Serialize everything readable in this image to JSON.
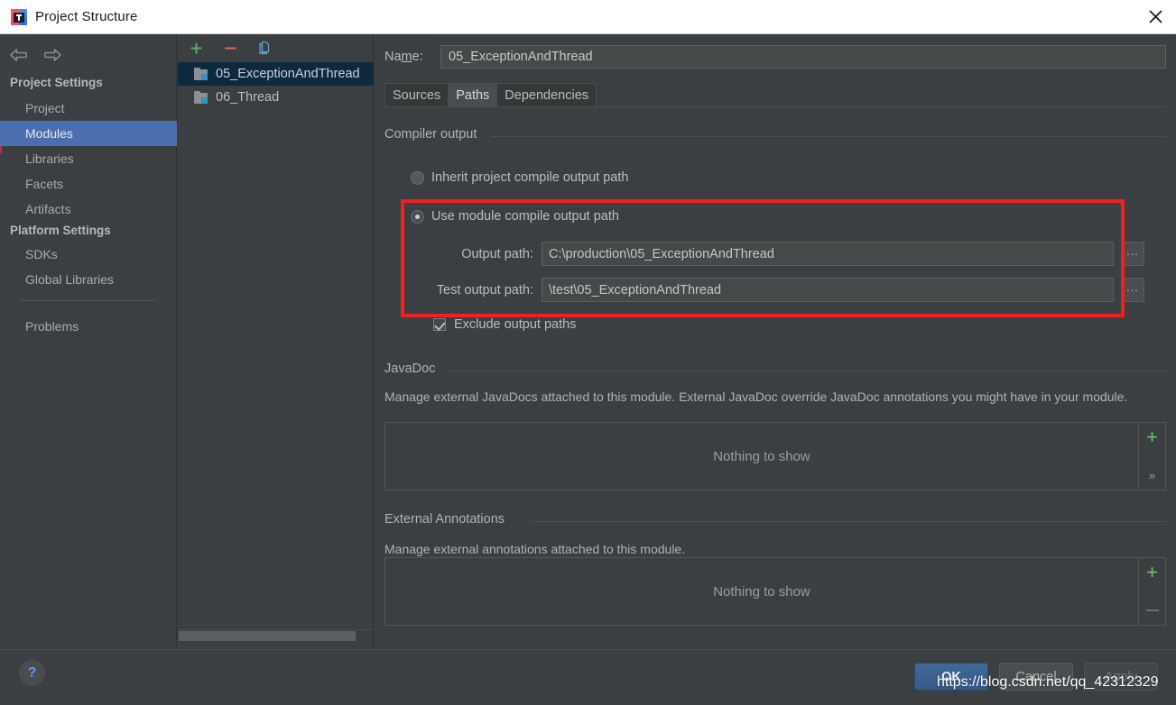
{
  "window": {
    "title": "Project Structure",
    "app_icon": "intellij-idea-icon",
    "close_icon": "close-icon"
  },
  "navigation": {
    "back_icon": "arrow-left-icon",
    "forward_icon": "arrow-right-icon"
  },
  "sidebar": {
    "sections": [
      {
        "header": "Project Settings",
        "items": [
          {
            "label": "Project",
            "selected": false
          },
          {
            "label": "Modules",
            "selected": true
          },
          {
            "label": "Libraries",
            "selected": false
          },
          {
            "label": "Facets",
            "selected": false
          },
          {
            "label": "Artifacts",
            "selected": false
          }
        ]
      },
      {
        "header": "Platform Settings",
        "items": [
          {
            "label": "SDKs",
            "selected": false
          },
          {
            "label": "Global Libraries",
            "selected": false
          }
        ]
      }
    ],
    "extra_item": {
      "label": "Problems",
      "selected": false
    },
    "selection_color": "#4b6eaf"
  },
  "module_panel": {
    "toolbar": [
      {
        "name": "add-module-button",
        "icon": "plus-icon",
        "color": "#59a869"
      },
      {
        "name": "remove-module-button",
        "icon": "minus-icon",
        "color": "#d9685f"
      },
      {
        "name": "copy-module-button",
        "icon": "copy-icon",
        "color": "#5a9ec9"
      }
    ],
    "modules": [
      {
        "label": "05_ExceptionAndThread",
        "selected": true
      },
      {
        "label": "06_Thread",
        "selected": false
      }
    ],
    "selection_color": "#0d293e",
    "scrollbar": "horizontal-scrollbar"
  },
  "main": {
    "name_label": "Name:",
    "name_label_mnemonic": "m",
    "name_value": "05_ExceptionAndThread",
    "tabs": [
      {
        "label": "Sources",
        "active": false
      },
      {
        "label": "Paths",
        "active": true
      },
      {
        "label": "Dependencies",
        "active": false
      }
    ],
    "compiler_output": {
      "group_title": "Compiler output",
      "inherit_option": {
        "label": "Inherit project compile output path",
        "selected": false
      },
      "module_option": {
        "label": "Use module compile output path",
        "selected": true
      },
      "output_path": {
        "label": "Output path:",
        "value": "C:\\production\\05_ExceptionAndThread",
        "browse_label": "..."
      },
      "test_output_path": {
        "label": "Test output path:",
        "value": "\\test\\05_ExceptionAndThread",
        "browse_label": "..."
      },
      "exclude_checkbox": {
        "label": "Exclude output paths",
        "checked": true
      }
    },
    "javadoc": {
      "group_title": "JavaDoc",
      "description": "Manage external JavaDocs attached to this module. External JavaDoc override JavaDoc annotations you might have in your module.",
      "empty_text": "Nothing to show",
      "add_label": "+",
      "expand_label": "»"
    },
    "external_annotations": {
      "group_title": "External Annotations",
      "description": "Manage external annotations attached to this module.",
      "empty_text": "Nothing to show",
      "add_label": "+",
      "remove_label": "−"
    }
  },
  "footer": {
    "help_label": "?",
    "buttons": [
      {
        "label": "OK",
        "style": "default",
        "enabled": true
      },
      {
        "label": "Cancel",
        "style": "normal",
        "enabled": true
      },
      {
        "label": "Apply",
        "style": "disabled",
        "enabled": false
      }
    ]
  },
  "watermark": {
    "text": "https://blog.csdn.net/qq_42312329"
  },
  "annotation": {
    "color": "#f51d1d",
    "shape": "rectangle"
  }
}
